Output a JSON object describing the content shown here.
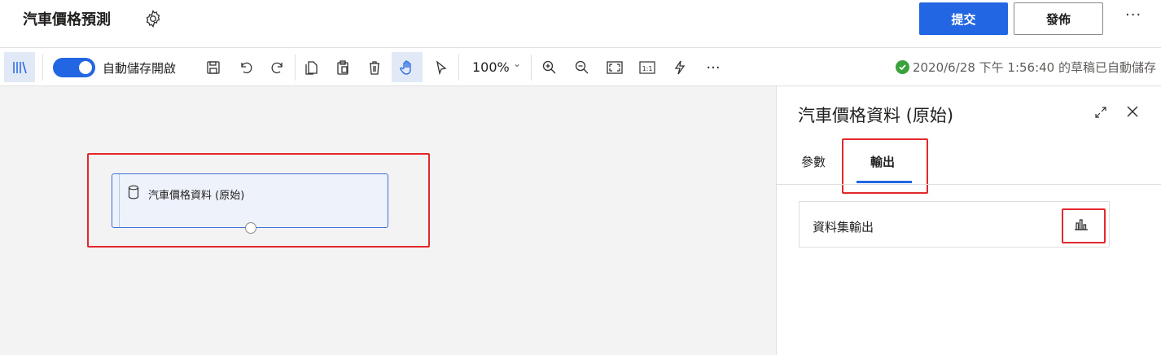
{
  "header": {
    "title": "汽車價格預測",
    "submit_label": "提交",
    "publish_label": "發佈",
    "more_label": "···"
  },
  "toolbar": {
    "autosave_toggle_label": "自動儲存開啟",
    "zoom_label": "100%",
    "more_label": "···",
    "autosave_status": "2020/6/28 下午 1:56:40 的草稿已自動儲存"
  },
  "canvas": {
    "node_label": "汽車價格資料 (原始)"
  },
  "panel": {
    "title": "汽車價格資料 (原始)",
    "tabs": [
      {
        "label": "參數"
      },
      {
        "label": "輸出"
      }
    ],
    "output_row_label": "資料集輸出"
  },
  "colors": {
    "accent": "#2266e3",
    "highlight": "#e3272a",
    "success": "#3ba13a",
    "canvas_bg": "#f3f3f3"
  }
}
